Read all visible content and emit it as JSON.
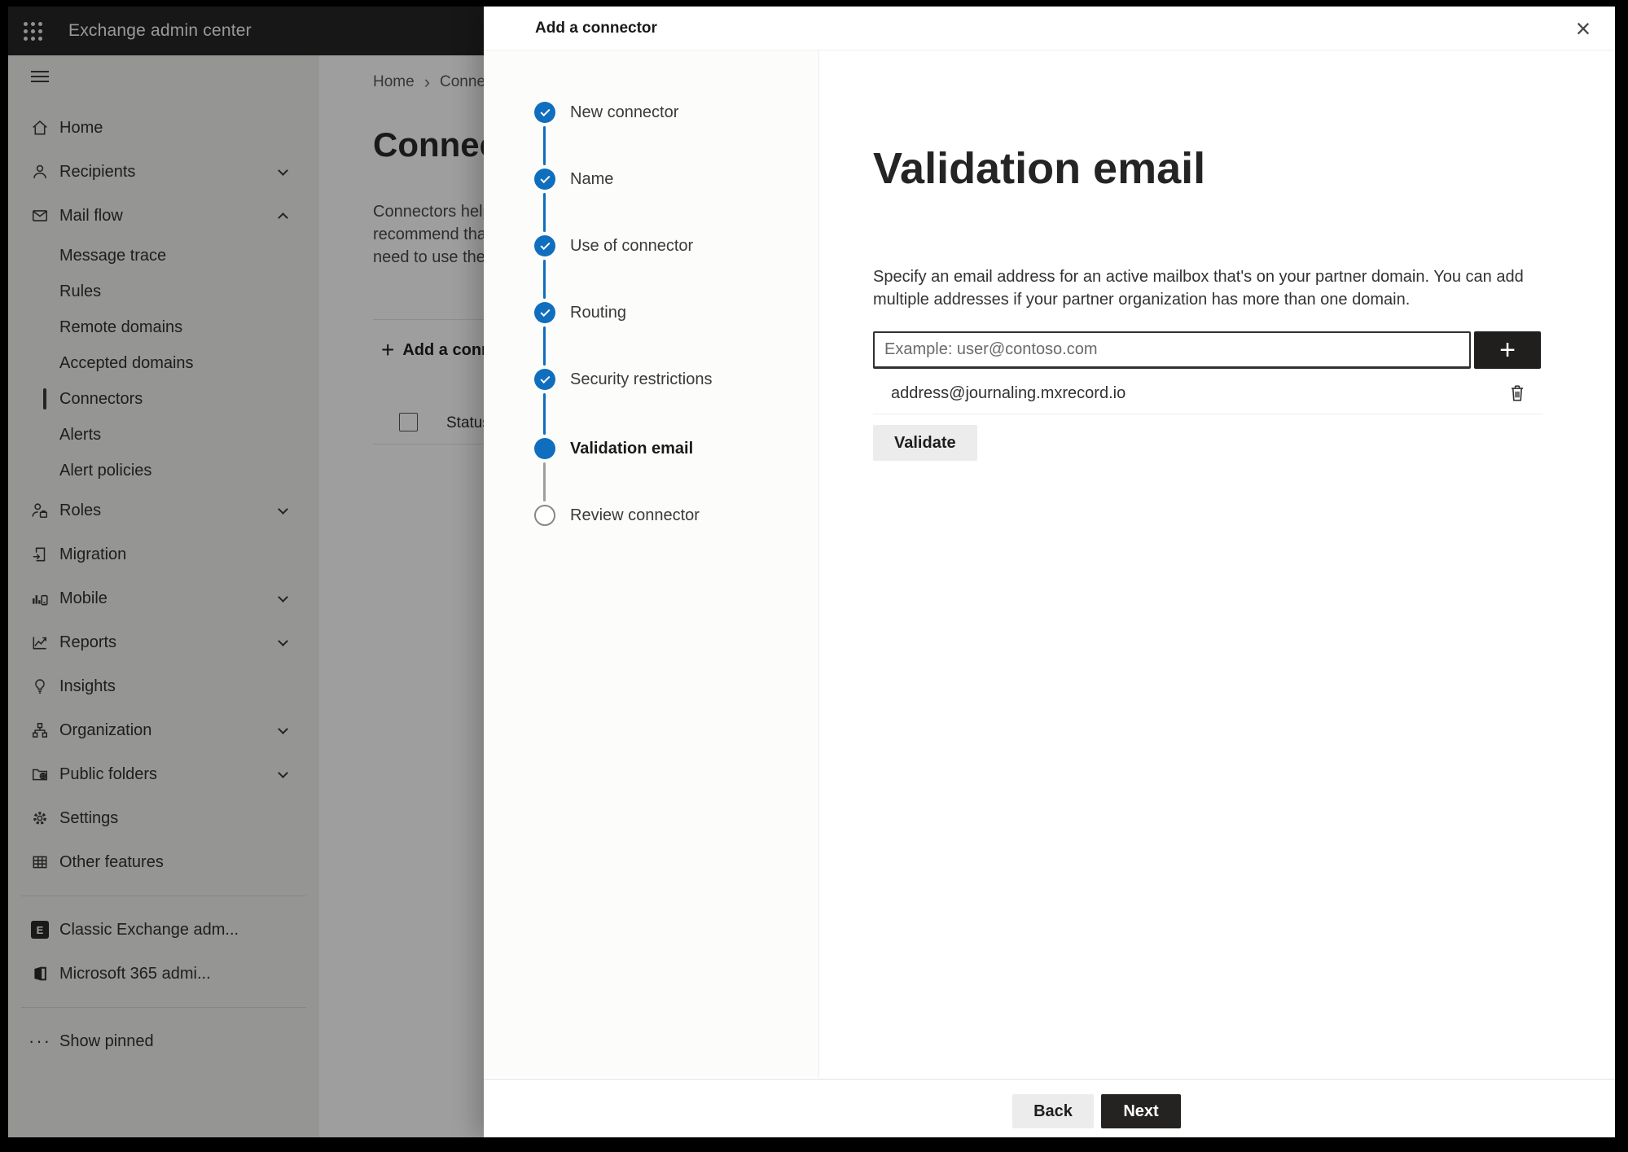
{
  "colors": {
    "accent_blue": "#106ebe",
    "topbar_bg": "#262626",
    "dark_button": "#211f1e",
    "scrim": "rgba(0,0,0,0.38)"
  },
  "icons": {
    "app_launcher": "grid-9-dots",
    "hamburger": "three-bars",
    "breadcrumb_separator": "›",
    "plus": "+",
    "close": "×",
    "check": "css-checkmark",
    "trash": "svg-trash-outline",
    "ellipsis": "···",
    "exchange_logo_letter": "E",
    "chevron": "css-chevron"
  },
  "topbar": {
    "title": "Exchange admin center"
  },
  "sidebar": {
    "items": [
      {
        "label": "Home",
        "icon": "home-icon"
      },
      {
        "label": "Recipients",
        "icon": "person-icon",
        "chevron": "down"
      },
      {
        "label": "Mail flow",
        "icon": "mail-icon",
        "chevron": "up",
        "expanded": true
      },
      {
        "label": "Message trace",
        "level": "sub"
      },
      {
        "label": "Rules",
        "level": "sub"
      },
      {
        "label": "Remote domains",
        "level": "sub"
      },
      {
        "label": "Accepted domains",
        "level": "sub"
      },
      {
        "label": "Connectors",
        "level": "sub",
        "selected": true
      },
      {
        "label": "Alerts",
        "level": "sub"
      },
      {
        "label": "Alert policies",
        "level": "sub"
      },
      {
        "label": "Roles",
        "icon": "roles-icon",
        "chevron": "down"
      },
      {
        "label": "Migration",
        "icon": "migration-icon"
      },
      {
        "label": "Mobile",
        "icon": "mobile-icon",
        "chevron": "down"
      },
      {
        "label": "Reports",
        "icon": "reports-icon",
        "chevron": "down"
      },
      {
        "label": "Insights",
        "icon": "insights-icon"
      },
      {
        "label": "Organization",
        "icon": "organization-icon",
        "chevron": "down"
      },
      {
        "label": "Public folders",
        "icon": "public-folders-icon",
        "chevron": "down"
      },
      {
        "label": "Settings",
        "icon": "settings-icon"
      },
      {
        "label": "Other features",
        "icon": "other-features-icon"
      },
      {
        "label": "Classic Exchange adm...",
        "icon": "exchange-logo"
      },
      {
        "label": "Microsoft 365 admi...",
        "icon": "microsoft-365-logo"
      },
      {
        "label": "Show pinned",
        "icon": "ellipsis-icon"
      }
    ]
  },
  "background_page": {
    "breadcrumb": {
      "home": "Home",
      "separator": "›",
      "current": "Conne"
    },
    "title_fragment": "Connect",
    "intro_lines": [
      "Connectors help",
      "recommend that",
      "need to use ther"
    ],
    "add_connector_label": "Add a conn",
    "status_header": "Status"
  },
  "panel": {
    "title": "Add a connector",
    "steps": [
      {
        "label": "New connector",
        "state": "complete"
      },
      {
        "label": "Name",
        "state": "complete"
      },
      {
        "label": "Use of connector",
        "state": "complete"
      },
      {
        "label": "Routing",
        "state": "complete"
      },
      {
        "label": "Security restrictions",
        "state": "complete"
      },
      {
        "label": "Validation email",
        "state": "current"
      },
      {
        "label": "Review connector",
        "state": "upcoming"
      }
    ],
    "content": {
      "heading": "Validation email",
      "description": "Specify an email address for an active mailbox that's on your partner domain. You can add multiple addresses if your partner organization has more than one domain.",
      "email_input": {
        "placeholder": "Example: user@contoso.com",
        "value": ""
      },
      "addresses": [
        "address@journaling.mxrecord.io"
      ],
      "validate_label": "Validate"
    },
    "footer": {
      "back_label": "Back",
      "next_label": "Next"
    }
  }
}
